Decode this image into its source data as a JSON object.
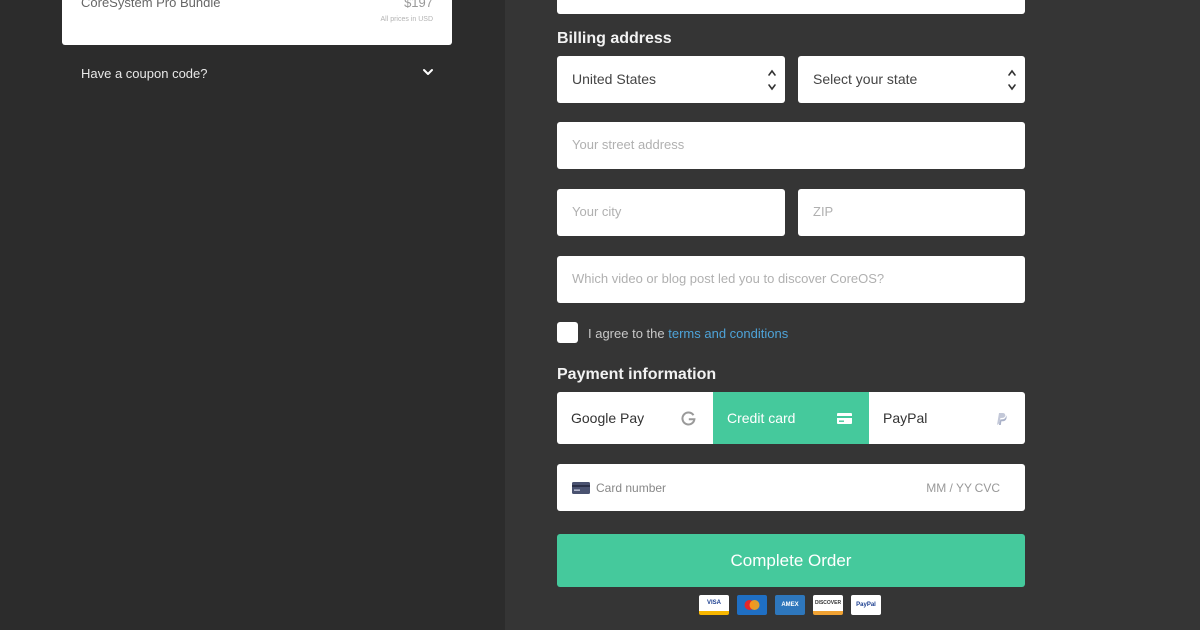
{
  "summary": {
    "product_name": "CoreSystem Pro Bundle",
    "price": "$197",
    "currency_note": "All prices in USD"
  },
  "coupon": {
    "label": "Have a coupon code?"
  },
  "billing": {
    "title": "Billing address",
    "country_value": "United States",
    "state_placeholder": "Select your state",
    "street_placeholder": "Your street address",
    "city_placeholder": "Your city",
    "zip_placeholder": "ZIP",
    "referral_placeholder": "Which video or blog post led you to discover CoreOS?"
  },
  "terms": {
    "prefix": "I agree to the",
    "link": "terms and conditions"
  },
  "payment": {
    "title": "Payment information",
    "tabs": [
      {
        "label": "Google Pay",
        "icon": "google-icon"
      },
      {
        "label": "Credit card",
        "icon": "credit-card-icon"
      },
      {
        "label": "PayPal",
        "icon": "paypal-icon"
      }
    ],
    "active_tab": "Credit card",
    "card_number_placeholder": "Card number",
    "expiry_placeholder": "MM / YY",
    "cvc_placeholder": "CVC"
  },
  "order": {
    "button_label": "Complete Order"
  },
  "badges": [
    {
      "label": "VISA",
      "color": "#f7b600"
    },
    {
      "label": "MC",
      "color": "#1f6fc4"
    },
    {
      "label": "AMEX",
      "color": "#2e77bc"
    },
    {
      "label": "DISCOVER",
      "color": "#f0a233"
    },
    {
      "label": "PayPal",
      "color": "#ffffff"
    }
  ],
  "colors": {
    "accent": "#45c99c",
    "link": "#4ea3d8"
  }
}
